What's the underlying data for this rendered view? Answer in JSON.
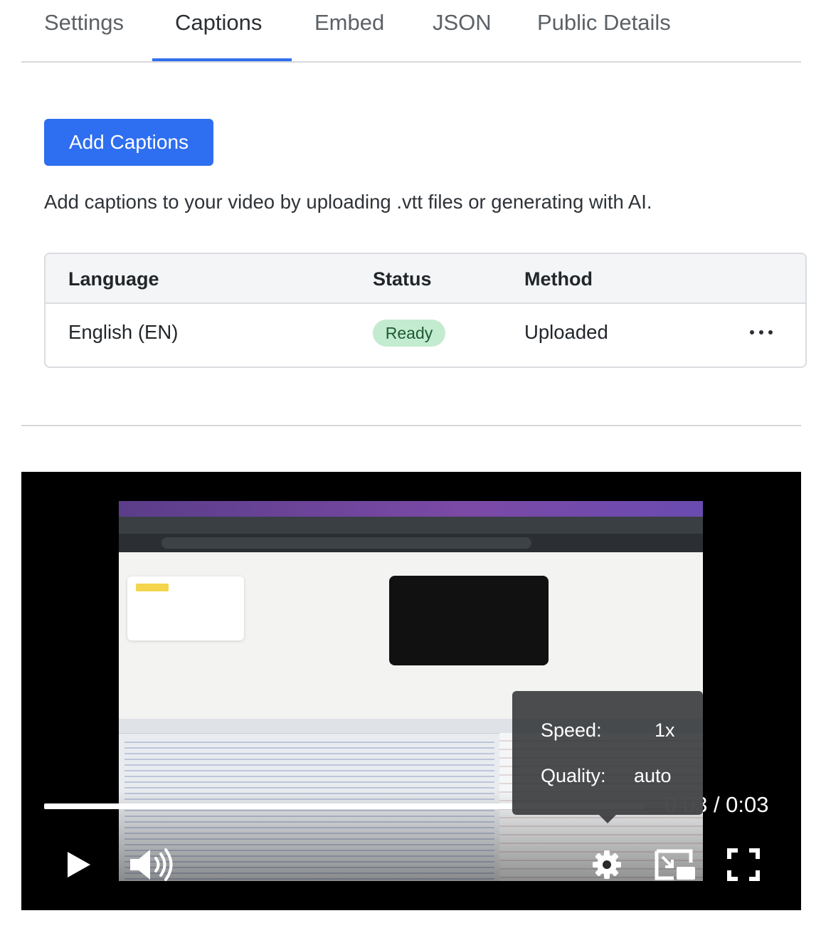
{
  "tabs": [
    {
      "label": "Settings"
    },
    {
      "label": "Captions"
    },
    {
      "label": "Embed"
    },
    {
      "label": "JSON"
    },
    {
      "label": "Public Details"
    }
  ],
  "active_tab": "Captions",
  "captions": {
    "add_button": "Add Captions",
    "description": "Add captions to your video by uploading .vtt files or generating with AI.",
    "table": {
      "headers": {
        "language": "Language",
        "status": "Status",
        "method": "Method"
      },
      "rows": [
        {
          "language": "English (EN)",
          "status": "Ready",
          "method": "Uploaded"
        }
      ]
    }
  },
  "player": {
    "time_current": "0:03",
    "time_total": "0:03",
    "time_display": "0:03 / 0:03",
    "progress": 1.0,
    "settings_menu": {
      "speed_label": "Speed:",
      "speed_value": "1x",
      "quality_label": "Quality:",
      "quality_value": "auto"
    },
    "controls": [
      "play-icon",
      "volume-icon",
      "gear-icon",
      "picture-in-picture-icon",
      "fullscreen-icon"
    ]
  },
  "colors": {
    "accent": "#2e6ef0",
    "badge_ready_bg": "#c3ebd0",
    "badge_ready_text": "#1c5a33"
  }
}
